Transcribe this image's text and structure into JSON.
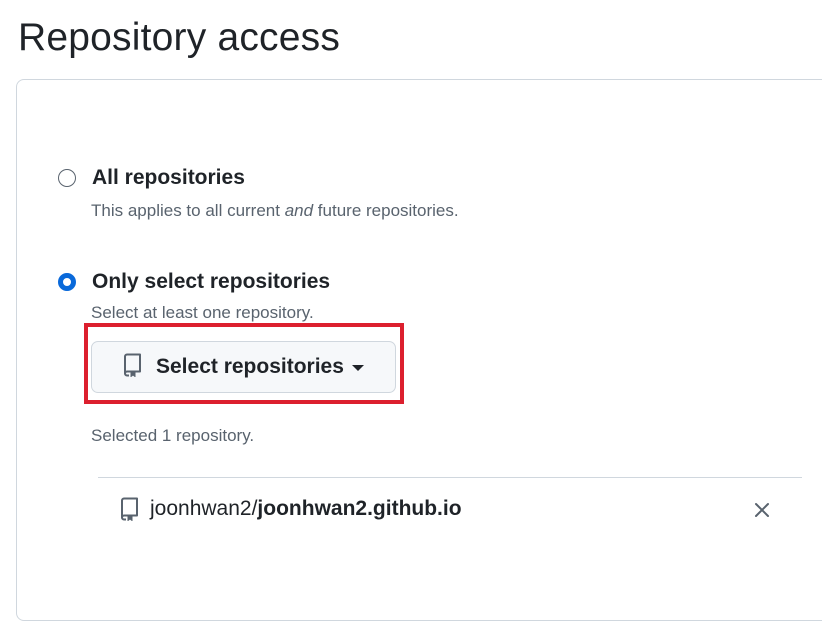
{
  "page": {
    "title": "Repository access"
  },
  "options": [
    {
      "label": "All repositories",
      "description_prefix": "This applies to all current ",
      "description_em": "and",
      "description_suffix": " future repositories.",
      "checked": false
    },
    {
      "label": "Only select repositories",
      "description": "Select at least one repository.",
      "checked": true
    }
  ],
  "select_button": {
    "label": "Select repositories",
    "icon": "repo-icon",
    "dropdown_icon": "caret-down-icon"
  },
  "selection": {
    "summary": "Selected 1 repository.",
    "repos": [
      {
        "owner": "joonhwan2/",
        "name": "joonhwan2.github.io",
        "icon": "repo-icon",
        "remove_icon": "close-icon"
      }
    ]
  },
  "colors": {
    "accent": "#0969da",
    "highlight": "#dc1f2e",
    "muted_text": "#59636e",
    "border": "#d0d7de"
  }
}
